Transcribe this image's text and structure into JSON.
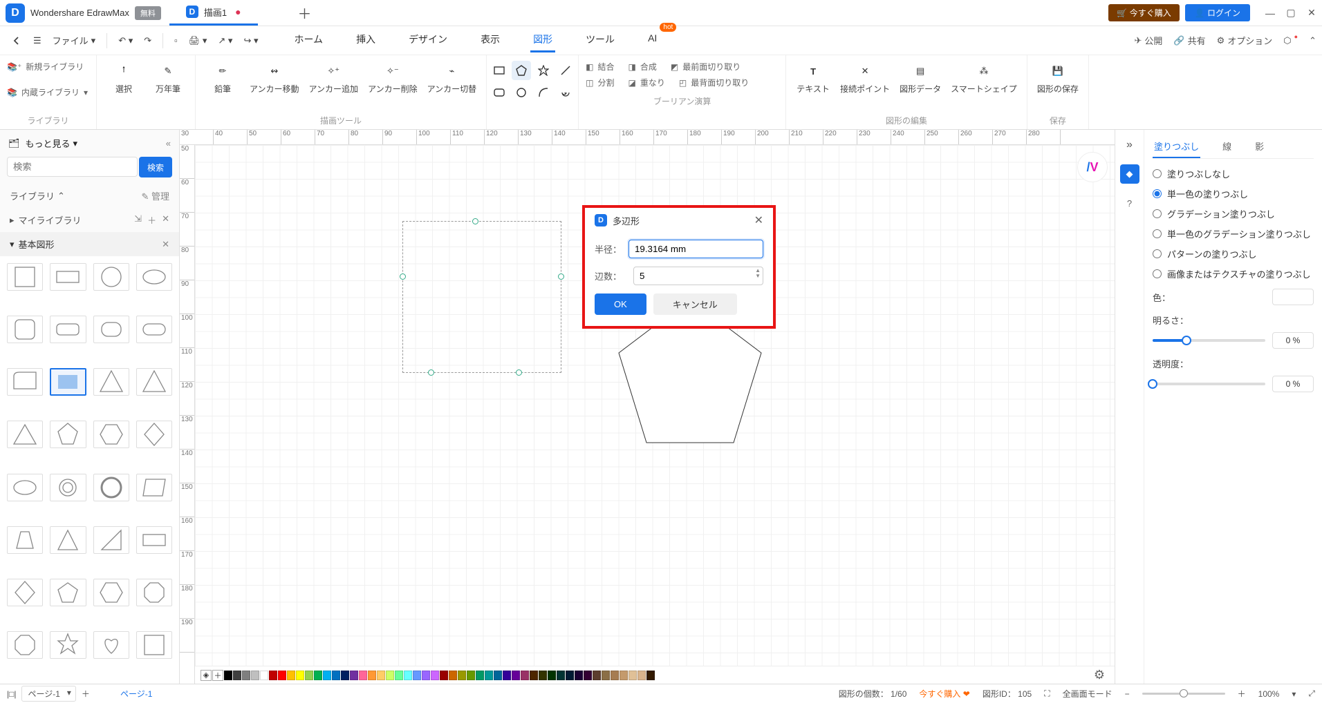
{
  "app": {
    "name": "Wondershare EdrawMax",
    "free_badge": "無料"
  },
  "doc_tab": {
    "name": "描画1",
    "dirty": true
  },
  "title_buttons": {
    "buy": "今すぐ購入",
    "login": "ログイン"
  },
  "quick": {
    "file": "ファイル"
  },
  "menu_tabs": [
    "ホーム",
    "挿入",
    "デザイン",
    "表示",
    "図形",
    "ツール",
    "AI"
  ],
  "menu_active_index": 4,
  "share": {
    "publish": "公開",
    "share": "共有",
    "options": "オプション"
  },
  "ribbon": {
    "library": {
      "new": "新規ライブラリ",
      "builtin": "内蔵ライブラリ",
      "title": "ライブラリ"
    },
    "select_group": {
      "items": [
        "選択",
        "万年筆"
      ]
    },
    "draw_tools": {
      "items": [
        "鉛筆",
        "アンカー移動",
        "アンカー追加",
        "アンカー削除",
        "アンカー切替"
      ],
      "title": "描画ツール"
    },
    "boolean": {
      "items": [
        "結合",
        "合成",
        "最前面切り取り",
        "分割",
        "重なり",
        "最背面切り取り"
      ],
      "title": "ブーリアン演算"
    },
    "edit": {
      "items": [
        "テキスト",
        "接続ポイント",
        "図形データ",
        "スマートシェイプ"
      ],
      "title": "図形の編集"
    },
    "save": {
      "item": "図形の保存",
      "title": "保存"
    }
  },
  "left": {
    "header": "もっと見る",
    "search_placeholder": "検索",
    "search_btn": "検索",
    "library_row": "ライブラリ",
    "manage": "管理",
    "my_library": "マイライブラリ",
    "section": "基本図形"
  },
  "ruler_top": [
    "30",
    "40",
    "50",
    "60",
    "70",
    "80",
    "90",
    "100",
    "110",
    "120",
    "130",
    "140",
    "150",
    "160",
    "170",
    "180",
    "190",
    "200",
    "210",
    "220",
    "230",
    "240",
    "250",
    "260",
    "270",
    "280"
  ],
  "ruler_left": [
    "50",
    "60",
    "70",
    "80",
    "90",
    "100",
    "110",
    "120",
    "130",
    "140",
    "150",
    "160",
    "170",
    "180",
    "190"
  ],
  "dialog": {
    "title": "多辺形",
    "radius_label": "半径：",
    "radius_value": "19.3164 mm",
    "sides_label": "辺数：",
    "sides_value": "5",
    "ok": "OK",
    "cancel": "キャンセル"
  },
  "right_tabs": [
    "塗りつぶし",
    "線",
    "影"
  ],
  "right_tab_active": 0,
  "fill_options": [
    "塗りつぶしなし",
    "単一色の塗りつぶし",
    "グラデーション塗りつぶし",
    "単一色のグラデーション塗りつぶし",
    "パターンの塗りつぶし",
    "画像またはテクスチャの塗りつぶし"
  ],
  "fill_selected_index": 1,
  "props": {
    "color_label": "色：",
    "brightness_label": "明るさ：",
    "brightness_value": "0 %",
    "brightness_pct": 30,
    "opacity_label": "透明度：",
    "opacity_value": "0 %",
    "opacity_pct": 0
  },
  "status": {
    "page_name": "ページ-1",
    "page_label": "ページ-1",
    "shape_count_label": "図形の個数：",
    "shape_count_value": "1/60",
    "promo": "今すぐ購入",
    "shape_id_label": "図形ID：",
    "shape_id_value": "105",
    "fullscreen": "全画面モード",
    "zoom": "100%"
  },
  "palette": [
    "#000000",
    "#3f3f3f",
    "#7f7f7f",
    "#bfbfbf",
    "#ffffff",
    "#c00000",
    "#ff0000",
    "#ffc000",
    "#ffff00",
    "#92d050",
    "#00b050",
    "#00b0f0",
    "#0070c0",
    "#002060",
    "#7030a0",
    "#ff6699",
    "#ff9933",
    "#ffcc66",
    "#ccff66",
    "#66ff99",
    "#66ffff",
    "#6699ff",
    "#9966ff",
    "#cc66ff",
    "#990000",
    "#cc6600",
    "#999900",
    "#669900",
    "#009966",
    "#009999",
    "#006699",
    "#330099",
    "#660099",
    "#993366",
    "#4d2600",
    "#333300",
    "#003300",
    "#003333",
    "#001a33",
    "#1a0033",
    "#330033",
    "#5c3d2e",
    "#8b6f47",
    "#a67c52",
    "#c49a6c",
    "#e0c097",
    "#d9b38c",
    "#331a00"
  ]
}
